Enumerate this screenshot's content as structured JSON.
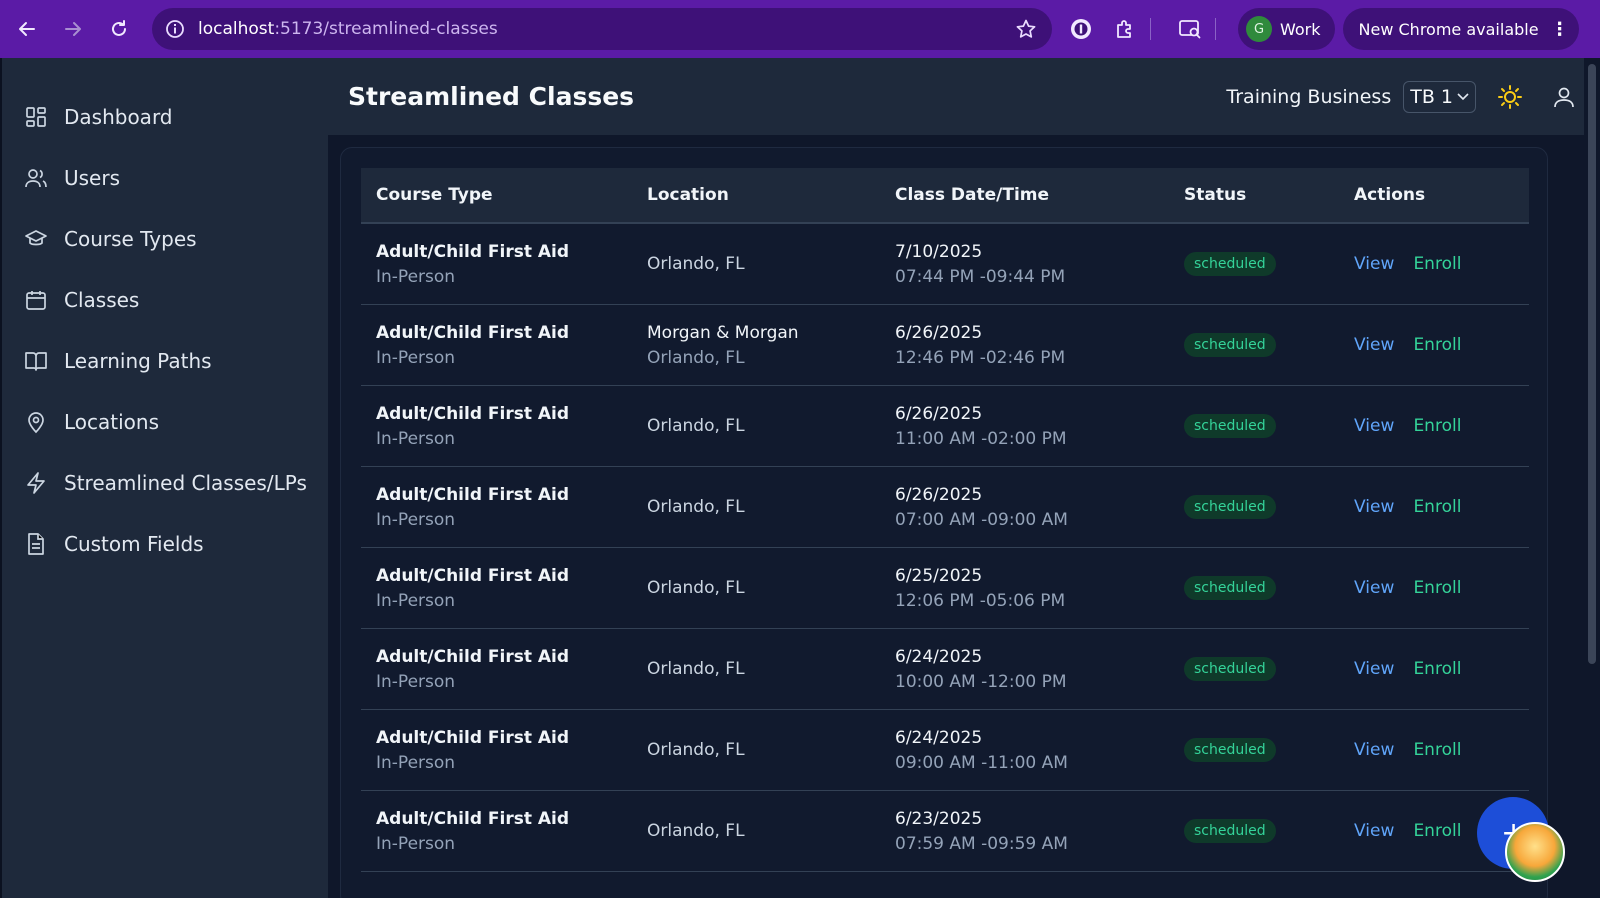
{
  "browser": {
    "url_host": "localhost",
    "url_path": ":5173/streamlined-classes",
    "profile_initial": "G",
    "profile_label": "Work",
    "update_label": "New Chrome available"
  },
  "sidebar": {
    "items": [
      {
        "label": "Dashboard",
        "icon": "grid-icon"
      },
      {
        "label": "Users",
        "icon": "users-icon"
      },
      {
        "label": "Course Types",
        "icon": "graduation-cap-icon"
      },
      {
        "label": "Classes",
        "icon": "calendar-icon"
      },
      {
        "label": "Learning Paths",
        "icon": "book-icon"
      },
      {
        "label": "Locations",
        "icon": "map-pin-icon"
      },
      {
        "label": "Streamlined Classes/LPs",
        "icon": "lightning-icon"
      },
      {
        "label": "Custom Fields",
        "icon": "document-icon"
      }
    ]
  },
  "header": {
    "title": "Streamlined Classes",
    "business_label": "Training Business",
    "business_select": "TB 1"
  },
  "table": {
    "columns": [
      "Course Type",
      "Location",
      "Class Date/Time",
      "Status",
      "Actions"
    ],
    "view_label": "View",
    "enroll_label": "Enroll",
    "rows": [
      {
        "course": "Adult/Child First Aid",
        "mode": "In-Person",
        "location_name": "",
        "location": "Orlando, FL",
        "date": "7/10/2025",
        "time": "07:44 PM -09:44 PM",
        "status": "scheduled"
      },
      {
        "course": "Adult/Child First Aid",
        "mode": "In-Person",
        "location_name": "Morgan & Morgan",
        "location": "Orlando, FL",
        "date": "6/26/2025",
        "time": "12:46 PM -02:46 PM",
        "status": "scheduled"
      },
      {
        "course": "Adult/Child First Aid",
        "mode": "In-Person",
        "location_name": "",
        "location": "Orlando, FL",
        "date": "6/26/2025",
        "time": "11:00 AM -02:00 PM",
        "status": "scheduled"
      },
      {
        "course": "Adult/Child First Aid",
        "mode": "In-Person",
        "location_name": "",
        "location": "Orlando, FL",
        "date": "6/26/2025",
        "time": "07:00 AM -09:00 AM",
        "status": "scheduled"
      },
      {
        "course": "Adult/Child First Aid",
        "mode": "In-Person",
        "location_name": "",
        "location": "Orlando, FL",
        "date": "6/25/2025",
        "time": "12:06 PM -05:06 PM",
        "status": "scheduled"
      },
      {
        "course": "Adult/Child First Aid",
        "mode": "In-Person",
        "location_name": "",
        "location": "Orlando, FL",
        "date": "6/24/2025",
        "time": "10:00 AM -12:00 PM",
        "status": "scheduled"
      },
      {
        "course": "Adult/Child First Aid",
        "mode": "In-Person",
        "location_name": "",
        "location": "Orlando, FL",
        "date": "6/24/2025",
        "time": "09:00 AM -11:00 AM",
        "status": "scheduled"
      },
      {
        "course": "Adult/Child First Aid",
        "mode": "In-Person",
        "location_name": "",
        "location": "Orlando, FL",
        "date": "6/23/2025",
        "time": "07:59 AM -09:59 AM",
        "status": "scheduled"
      }
    ]
  },
  "fab_label": "+",
  "colors": {
    "browser_frame": "#5b1ba6",
    "sidebar_bg": "#1e293b",
    "page_bg": "#0f172a",
    "link_view": "#60a5fa",
    "link_enroll": "#34d399",
    "status_scheduled": "#34d399"
  }
}
